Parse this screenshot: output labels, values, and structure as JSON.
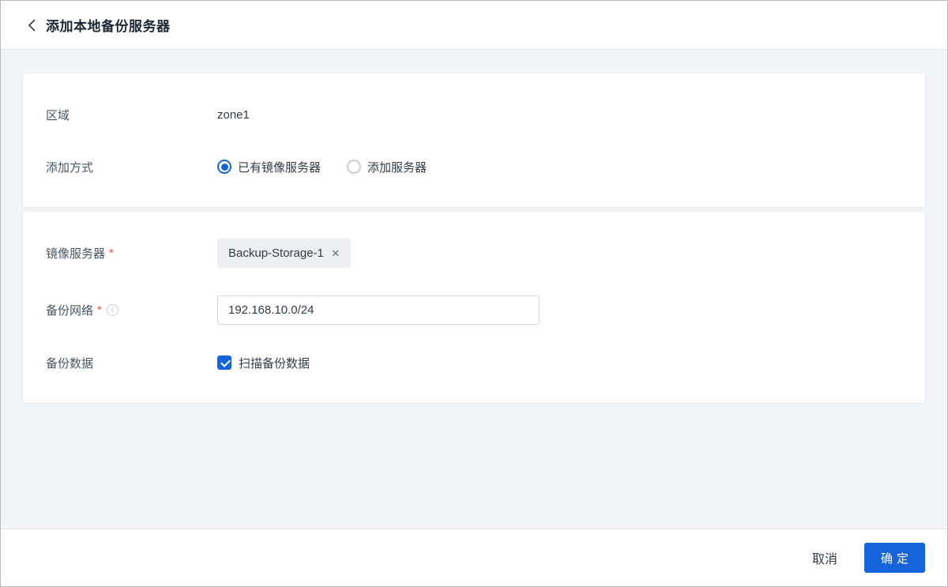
{
  "window": {
    "title": "添加本地备份服务器"
  },
  "form": {
    "zone": {
      "label": "区域",
      "value": "zone1"
    },
    "method": {
      "label": "添加方式",
      "options": [
        {
          "label": "已有镜像服务器",
          "selected": true
        },
        {
          "label": "添加服务器",
          "selected": false
        }
      ]
    },
    "mirror_server": {
      "label": "镜像服务器",
      "required_mark": "*",
      "tag": "Backup-Storage-1",
      "remove_icon": "×"
    },
    "backup_network": {
      "label": "备份网络",
      "required_mark": "*",
      "info_icon": "i",
      "value": "192.168.10.0/24"
    },
    "backup_data": {
      "label": "备份数据",
      "checkbox_label": "扫描备份数据",
      "checked": true
    }
  },
  "footer": {
    "cancel_label": "取消",
    "confirm_label": "确定"
  },
  "colors": {
    "primary": "#1664dc",
    "required": "#e0564a",
    "page_background": "#f3f4f7",
    "card_background": "#ffffff"
  }
}
